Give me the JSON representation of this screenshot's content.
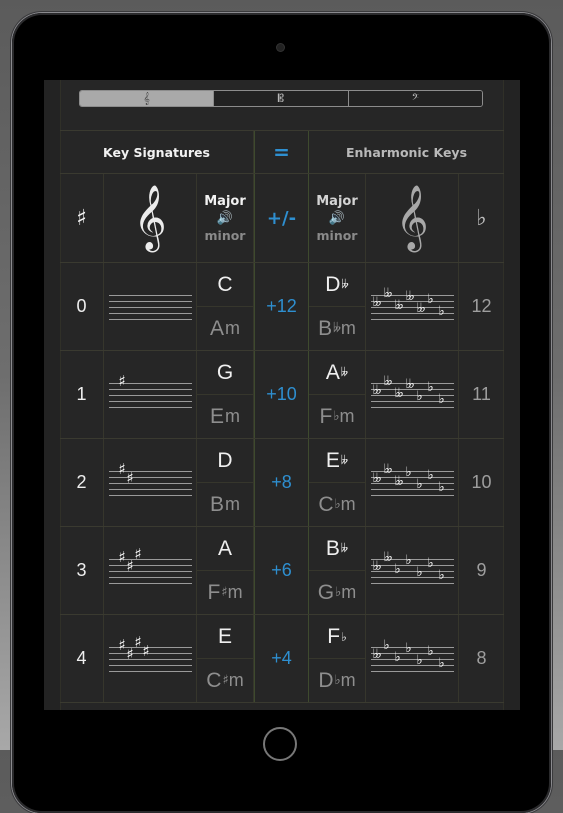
{
  "clef_selector": {
    "segments": [
      {
        "icon": "treble-clef-icon",
        "glyph": "𝄞",
        "selected": true
      },
      {
        "icon": "alto-clef-icon",
        "glyph": "𝄡",
        "selected": false
      },
      {
        "icon": "bass-clef-icon",
        "glyph": "𝄢",
        "selected": false
      }
    ]
  },
  "header": {
    "key_signatures": "Key Signatures",
    "equals": "=",
    "enharmonic_keys": "Enharmonic Keys",
    "sharp_symbol": "♯",
    "flat_symbol": "♭",
    "clef_glyph": "𝄞",
    "major_label": "Major",
    "minor_label": "minor",
    "speaker_glyph": "🔊",
    "plus_minus": "+/-"
  },
  "rows": [
    {
      "sharps": "0",
      "major": "C",
      "minor": "Am",
      "minor_acc": "",
      "interval": "+12",
      "enh_major": "D",
      "enh_major_acc": "𝄫",
      "enh_minor": "B",
      "enh_minor_acc": "𝄫",
      "flats": "12"
    },
    {
      "sharps": "1",
      "major": "G",
      "minor": "Em",
      "minor_acc": "",
      "interval": "+10",
      "enh_major": "A",
      "enh_major_acc": "𝄫",
      "enh_minor": "F",
      "enh_minor_acc": "♭",
      "flats": "11"
    },
    {
      "sharps": "2",
      "major": "D",
      "minor": "Bm",
      "minor_acc": "",
      "interval": "+8",
      "enh_major": "E",
      "enh_major_acc": "𝄫",
      "enh_minor": "C",
      "enh_minor_acc": "♭",
      "flats": "10"
    },
    {
      "sharps": "3",
      "major": "A",
      "minor": "F",
      "minor_acc": "♯",
      "interval": "+6",
      "enh_major": "B",
      "enh_major_acc": "𝄫",
      "enh_minor": "G",
      "enh_minor_acc": "♭",
      "flats": "9"
    },
    {
      "sharps": "4",
      "major": "E",
      "minor": "C",
      "minor_acc": "♯",
      "interval": "+4",
      "enh_major": "F",
      "enh_major_acc": "♭",
      "enh_minor": "D",
      "enh_minor_acc": "♭",
      "flats": "8"
    }
  ],
  "colors": {
    "accent_blue": "#2e8fd0",
    "background": "#262626"
  }
}
